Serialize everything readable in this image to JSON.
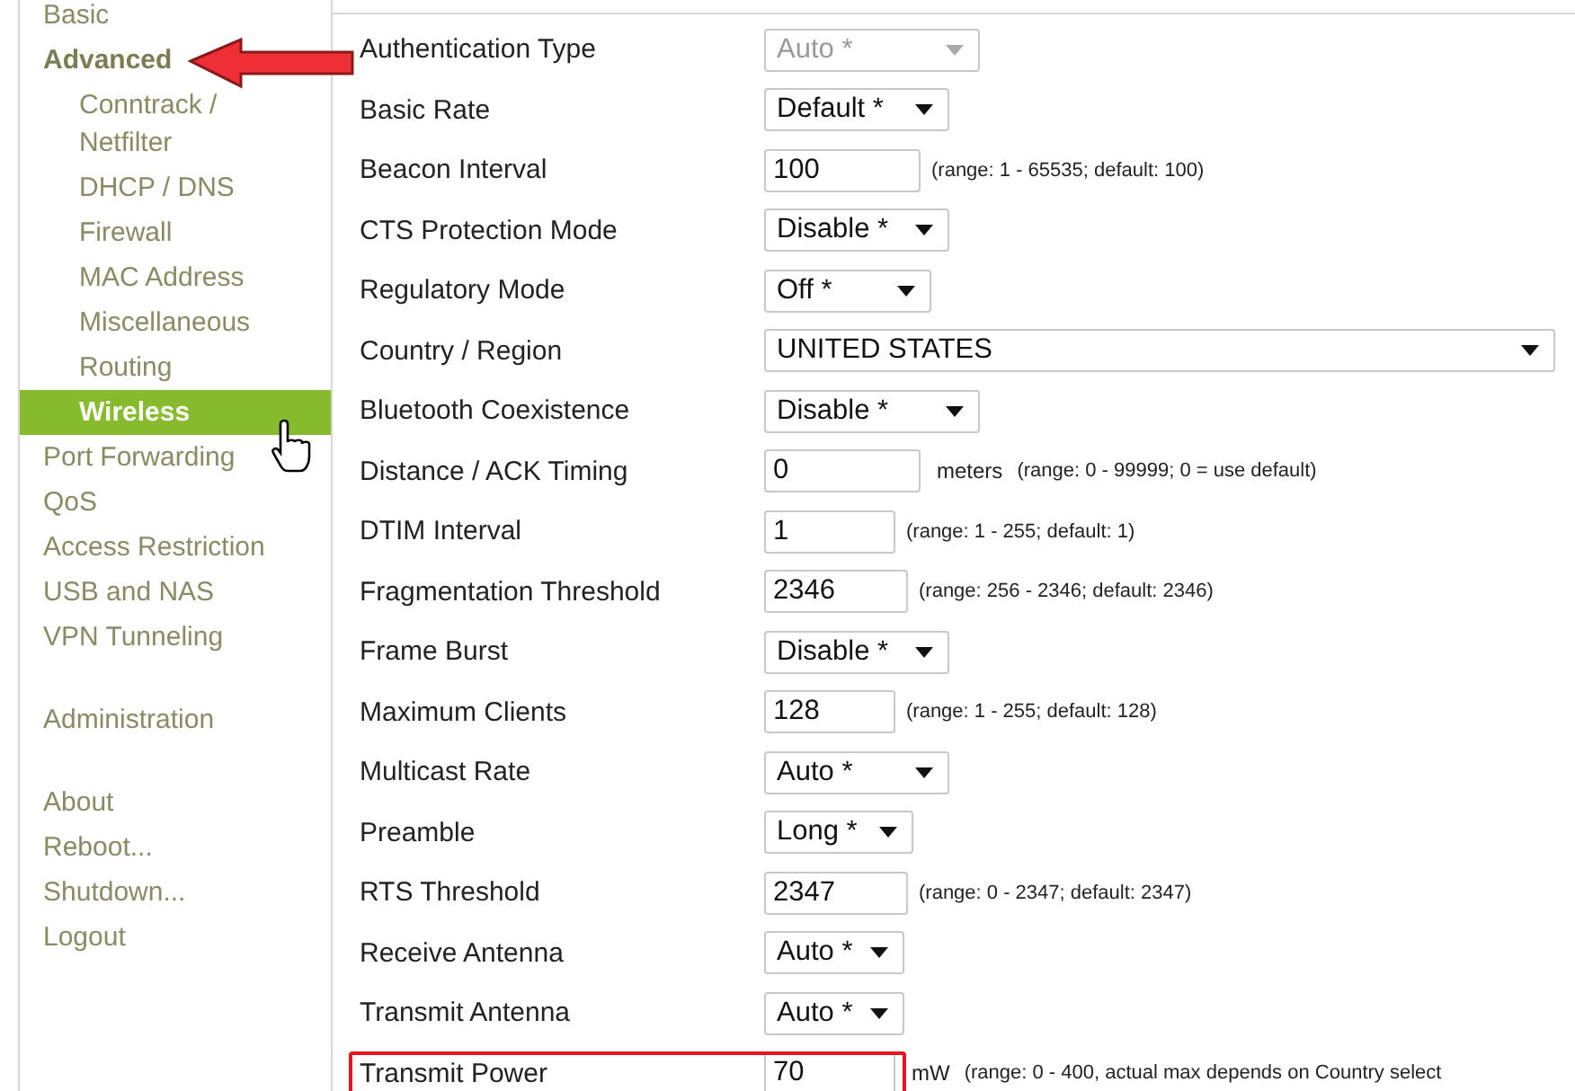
{
  "sidebar": {
    "groups": [
      {
        "items": [
          {
            "label": "Basic",
            "selected": false
          },
          {
            "label": "Advanced",
            "selected": false,
            "children": [
              {
                "label": "Conntrack / Netfilter",
                "selected": false
              },
              {
                "label": "DHCP / DNS",
                "selected": false
              },
              {
                "label": "Firewall",
                "selected": false
              },
              {
                "label": "MAC Address",
                "selected": false
              },
              {
                "label": "Miscellaneous",
                "selected": false
              },
              {
                "label": "Routing",
                "selected": false
              },
              {
                "label": "Wireless",
                "selected": true
              }
            ]
          },
          {
            "label": "Port Forwarding",
            "selected": false
          },
          {
            "label": "QoS",
            "selected": false
          },
          {
            "label": "Access Restriction",
            "selected": false
          },
          {
            "label": "USB and NAS",
            "selected": false
          },
          {
            "label": "VPN Tunneling",
            "selected": false
          }
        ]
      },
      {
        "items": [
          {
            "label": "Administration",
            "selected": false
          }
        ]
      },
      {
        "items": [
          {
            "label": "About",
            "selected": false
          },
          {
            "label": "Reboot...",
            "selected": false
          },
          {
            "label": "Shutdown...",
            "selected": false
          },
          {
            "label": "Logout",
            "selected": false
          }
        ]
      }
    ]
  },
  "settings": [
    {
      "label": "Authentication Type",
      "kind": "select",
      "value": "Auto *",
      "disabled": true,
      "highlighted": false
    },
    {
      "label": "Basic Rate",
      "kind": "select",
      "value": "Default *",
      "disabled": false,
      "highlighted": false
    },
    {
      "label": "Beacon Interval",
      "kind": "input",
      "value": "100",
      "note": "(range: 1 - 65535; default: 100)",
      "disabled": false,
      "highlighted": false
    },
    {
      "label": "CTS Protection Mode",
      "kind": "select",
      "value": "Disable *",
      "disabled": false,
      "highlighted": false
    },
    {
      "label": "Regulatory Mode",
      "kind": "select",
      "value": "Off *",
      "disabled": false,
      "highlighted": false
    },
    {
      "label": "Country / Region",
      "kind": "select",
      "value": "UNITED STATES",
      "disabled": false,
      "highlighted": false
    },
    {
      "label": "Bluetooth Coexistence",
      "kind": "select",
      "value": "Disable *",
      "disabled": false,
      "highlighted": false
    },
    {
      "label": "Distance / ACK Timing",
      "kind": "input",
      "value": "0",
      "unit": "meters",
      "note": "(range: 0 - 99999; 0 = use default)",
      "disabled": false,
      "highlighted": false
    },
    {
      "label": "DTIM Interval",
      "kind": "input",
      "value": "1",
      "note": "(range: 1 - 255; default: 1)",
      "disabled": false,
      "highlighted": false
    },
    {
      "label": "Fragmentation Threshold",
      "kind": "input",
      "value": "2346",
      "note": "(range: 256 - 2346; default: 2346)",
      "disabled": false,
      "highlighted": false
    },
    {
      "label": "Frame Burst",
      "kind": "select",
      "value": "Disable *",
      "disabled": false,
      "highlighted": false
    },
    {
      "label": "Maximum Clients",
      "kind": "input",
      "value": "128",
      "note": "(range: 1 - 255; default: 128)",
      "disabled": false,
      "highlighted": false
    },
    {
      "label": "Multicast Rate",
      "kind": "select",
      "value": "Auto *",
      "disabled": false,
      "highlighted": false
    },
    {
      "label": "Preamble",
      "kind": "select",
      "value": "Long *",
      "disabled": false,
      "highlighted": false
    },
    {
      "label": "RTS Threshold",
      "kind": "input",
      "value": "2347",
      "note": "(range: 0 - 2347; default: 2347)",
      "disabled": false,
      "highlighted": false
    },
    {
      "label": "Receive Antenna",
      "kind": "select",
      "value": "Auto *",
      "disabled": false,
      "highlighted": false
    },
    {
      "label": "Transmit Antenna",
      "kind": "select",
      "value": "Auto *",
      "disabled": false,
      "highlighted": false
    },
    {
      "label": "Transmit Power",
      "kind": "input",
      "value": "70",
      "unit": "mW",
      "note": "(range: 0 - 400, actual max depends on Country select",
      "disabled": false,
      "highlighted": true
    }
  ]
}
